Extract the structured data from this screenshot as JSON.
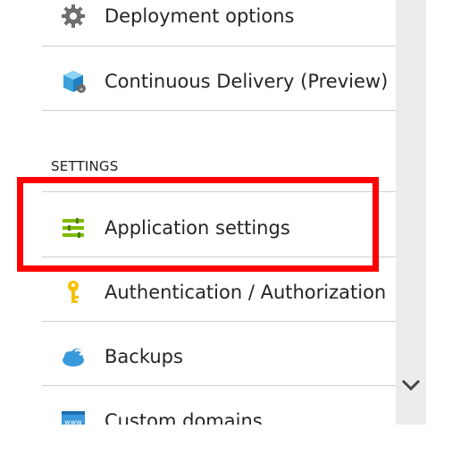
{
  "menu": {
    "items_top": [
      {
        "label": "Deployment options",
        "icon": "gear-icon"
      },
      {
        "label": "Continuous Delivery (Preview)",
        "icon": "package-icon"
      }
    ],
    "section_header": "SETTINGS",
    "settings_items": [
      {
        "label": "Application settings",
        "icon": "settings-sliders-icon"
      },
      {
        "label": "Authentication / Authorization",
        "icon": "key-icon"
      },
      {
        "label": "Backups",
        "icon": "cloud-icon"
      },
      {
        "label": "Custom domains",
        "icon": "www-icon"
      }
    ]
  },
  "highlight": {
    "target": "Application settings",
    "color": "#ff0000"
  },
  "scrollbar": {
    "icon": "chevron-down-icon"
  }
}
